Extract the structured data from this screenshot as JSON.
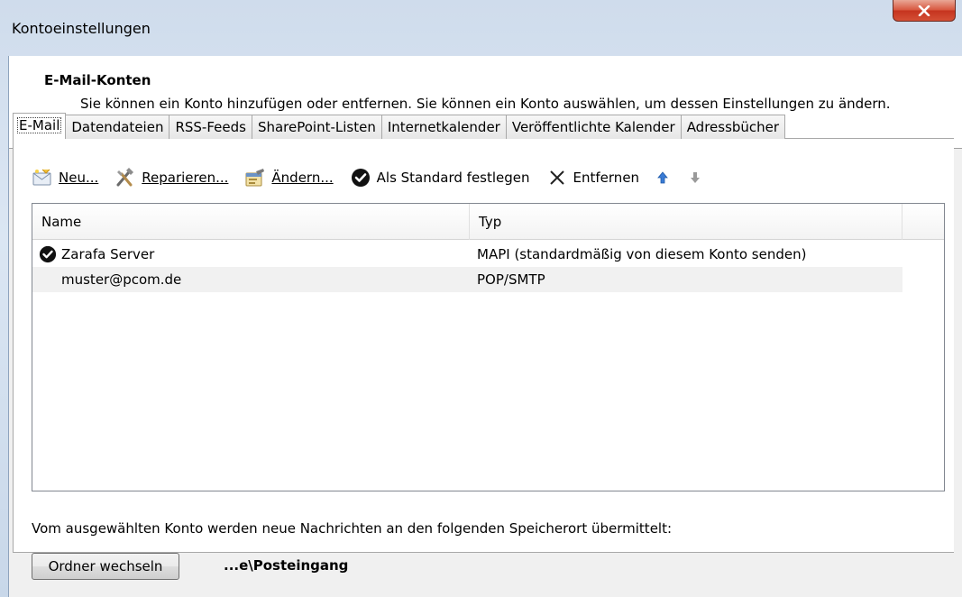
{
  "window": {
    "title": "Kontoeinstellungen",
    "close_icon": "close-icon"
  },
  "header": {
    "title": "E-Mail-Konten",
    "description": "Sie können ein Konto hinzufügen oder entfernen. Sie können ein Konto auswählen, um dessen Einstellungen zu ändern."
  },
  "tabs": [
    {
      "label": "E-Mail",
      "active": true
    },
    {
      "label": "Datendateien"
    },
    {
      "label": "RSS-Feeds"
    },
    {
      "label": "SharePoint-Listen"
    },
    {
      "label": "Internetkalender"
    },
    {
      "label": "Veröffentlichte Kalender"
    },
    {
      "label": "Adressbücher"
    }
  ],
  "toolbar": {
    "new": {
      "label": "Neu...",
      "icon": "new-mail-icon"
    },
    "repair": {
      "label": "Reparieren...",
      "icon": "repair-tools-icon"
    },
    "change": {
      "label": "Ändern...",
      "icon": "change-account-icon"
    },
    "set_default": {
      "label": "Als Standard festlegen",
      "icon": "checkmark-circle-icon"
    },
    "remove": {
      "label": "Entfernen",
      "icon": "x-icon"
    },
    "move_up_icon": "arrow-up-icon",
    "move_down_icon": "arrow-down-icon"
  },
  "list": {
    "columns": [
      "Name",
      "Typ"
    ],
    "rows": [
      {
        "name": "Zarafa Server",
        "type": "MAPI (standardmäßig von diesem Konto senden)",
        "default": true
      },
      {
        "name": "muster@pcom.de",
        "type": "POP/SMTP",
        "default": false
      }
    ]
  },
  "footer": {
    "delivery_text": "Vom ausgewählten Konto werden neue Nachrichten an den folgenden Speicherort übermittelt:",
    "change_folder_button": "Ordner wechseln",
    "folder_path": "...e\\Posteingang"
  },
  "colors": {
    "close_button": "#c5341f",
    "selection_alt_row": "#f1f1f1",
    "arrow_up": "#3a7bd5",
    "arrow_down": "#9a9a9a"
  }
}
